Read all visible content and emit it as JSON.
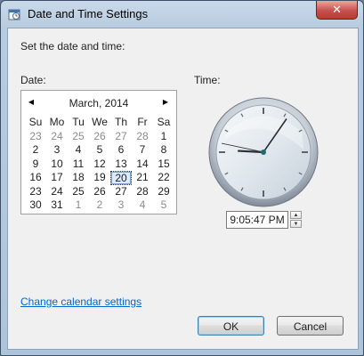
{
  "window": {
    "title": "Date and Time Settings",
    "close_glyph": "✕",
    "icon": "date-time-settings-icon"
  },
  "instruction": "Set the date and time:",
  "date_label": "Date:",
  "time_label": "Time:",
  "calendar": {
    "month_title": "March, 2014",
    "prev_glyph": "◀",
    "next_glyph": "▶",
    "weekdays": [
      "Su",
      "Mo",
      "Tu",
      "We",
      "Th",
      "Fr",
      "Sa"
    ],
    "weeks": [
      [
        "23",
        "24",
        "25",
        "26",
        "27",
        "28",
        "1"
      ],
      [
        "2",
        "3",
        "4",
        "5",
        "6",
        "7",
        "8"
      ],
      [
        "9",
        "10",
        "11",
        "12",
        "13",
        "14",
        "15"
      ],
      [
        "16",
        "17",
        "18",
        "19",
        "20",
        "21",
        "22"
      ],
      [
        "23",
        "24",
        "25",
        "26",
        "27",
        "28",
        "29"
      ],
      [
        "30",
        "31",
        "1",
        "2",
        "3",
        "4",
        "5"
      ]
    ],
    "selected_day": "20"
  },
  "clock": {
    "hours": 9,
    "minutes": 5,
    "seconds": 47
  },
  "time_value": "9:05:47 PM",
  "link_text": "Change calendar settings",
  "buttons": {
    "ok": "OK",
    "cancel": "Cancel"
  }
}
